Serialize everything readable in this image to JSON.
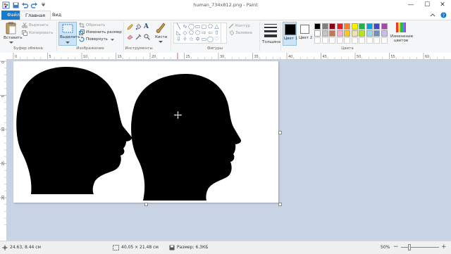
{
  "window": {
    "title": "human_734x812.png - Paint",
    "controls": {
      "minimize": "—",
      "maximize": "☐",
      "close": "✕"
    }
  },
  "tabs": {
    "file": "Файл",
    "home": "Главная",
    "view": "Вид"
  },
  "ribbon": {
    "clipboard": {
      "paste": "Вставить",
      "cut": "Вырезать",
      "copy": "Копировать",
      "label": "Буфер обмена"
    },
    "image": {
      "select": "Выделить",
      "crop": "Обрезать",
      "resize": "Изменить размер",
      "rotate": "Повернуть",
      "label": "Изображение"
    },
    "tools": {
      "label": "Инструменты",
      "text_tool": "A"
    },
    "brushes": {
      "label": "Кисти"
    },
    "shapes": {
      "label": "Фигуры",
      "outline": "Контур",
      "fill": "Заливка"
    },
    "size": {
      "label": "Толщина"
    },
    "colors": {
      "color1": "Цвет 1",
      "color2": "Цвет 2",
      "edit": "Изменение цветов",
      "label": "Цвета",
      "color1_value": "#000000",
      "color2_value": "#ffffff",
      "palette_row1": [
        "#000000",
        "#7f7f7f",
        "#880015",
        "#ed1c24",
        "#ff7f27",
        "#fff200",
        "#22b14c",
        "#00a2e8",
        "#3f48cc",
        "#a349a4"
      ],
      "palette_row2": [
        "#ffffff",
        "#c3c3c3",
        "#b97a57",
        "#ffaec9",
        "#ffc90e",
        "#efe4b0",
        "#b5e61d",
        "#99d9ea",
        "#7092be",
        "#c8bfe7"
      ]
    }
  },
  "ruler": {
    "h_labels": [
      "0",
      "5",
      "10",
      "15",
      "20",
      "25",
      "30",
      "35",
      "40",
      "45",
      "50",
      "55",
      "60"
    ],
    "v_labels": [
      "0",
      "5",
      "10",
      "15",
      "20"
    ]
  },
  "status": {
    "cursor_pos": "24.63, 8.44 см",
    "selection_size": "40.05 × 21.48 см",
    "file_size": "Размер: 6.3КБ",
    "zoom": "50%"
  }
}
